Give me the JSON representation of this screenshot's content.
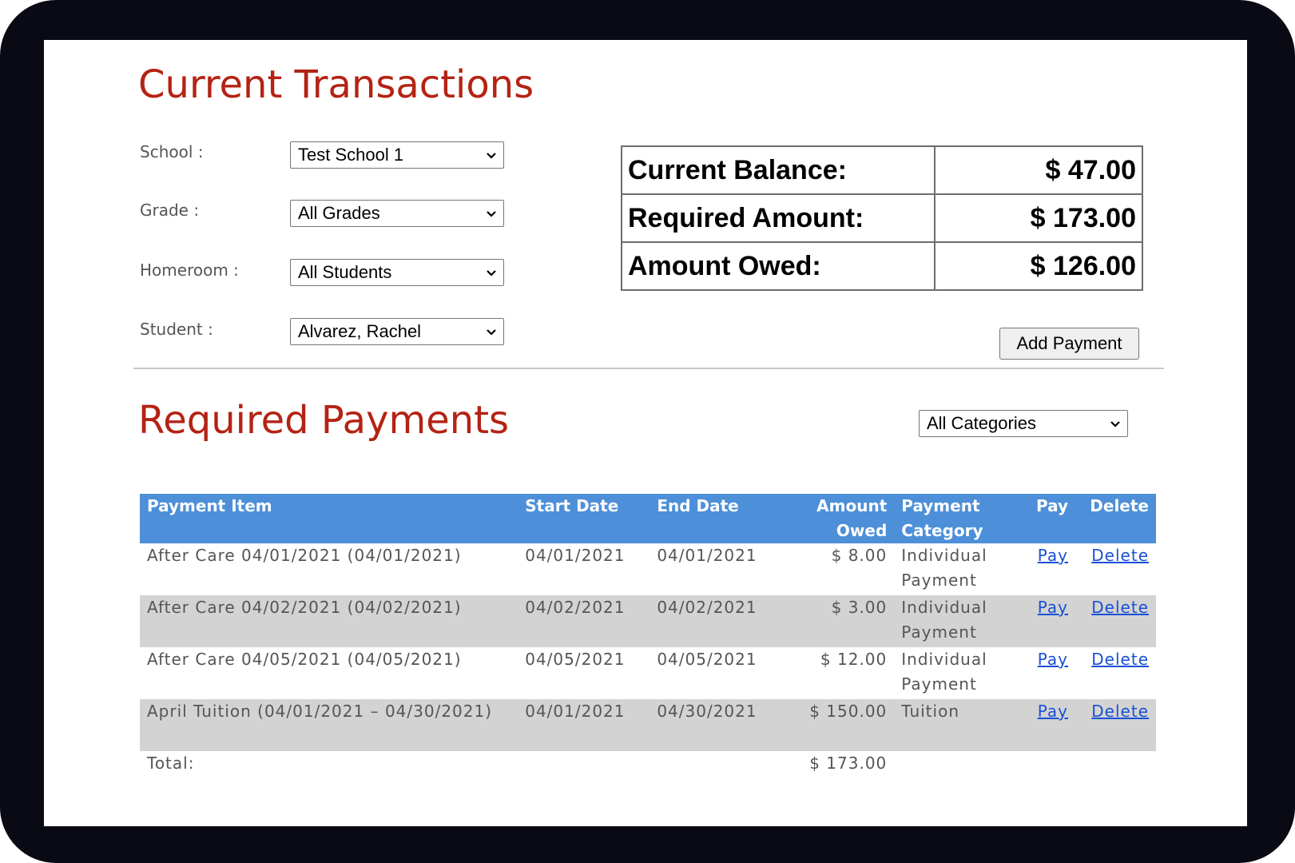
{
  "current_transactions": {
    "title": "Current Transactions",
    "filters": [
      {
        "label": "School :",
        "value": "Test School 1"
      },
      {
        "label": "Grade :",
        "value": "All Grades"
      },
      {
        "label": "Homeroom :",
        "value": "All Students"
      },
      {
        "label": "Student :",
        "value": "Alvarez, Rachel"
      }
    ],
    "balance": [
      {
        "label": "Current Balance:",
        "value": "$ 47.00"
      },
      {
        "label": "Required Amount:",
        "value": "$ 173.00"
      },
      {
        "label": "Amount Owed:",
        "value": "$ 126.00"
      }
    ],
    "add_payment_label": "Add Payment"
  },
  "required_payments": {
    "title": "Required Payments",
    "category_filter": "All Categories",
    "columns": {
      "item": "Payment Item",
      "start": "Start Date",
      "end": "End Date",
      "amount": "Amount Owed",
      "category": "Payment Category",
      "pay": "Pay",
      "delete": "Delete"
    },
    "rows": [
      {
        "item": "After Care 04/01/2021 (04/01/2021)",
        "start": "04/01/2021",
        "end": "04/01/2021",
        "amount": "$ 8.00",
        "category": "Individual Payment",
        "pay": "Pay",
        "delete": "Delete"
      },
      {
        "item": "After Care 04/02/2021 (04/02/2021)",
        "start": "04/02/2021",
        "end": "04/02/2021",
        "amount": "$ 3.00",
        "category": "Individual Payment",
        "pay": "Pay",
        "delete": "Delete"
      },
      {
        "item": "After Care 04/05/2021 (04/05/2021)",
        "start": "04/05/2021",
        "end": "04/05/2021",
        "amount": "$ 12.00",
        "category": "Individual Payment",
        "pay": "Pay",
        "delete": "Delete"
      },
      {
        "item": "April Tuition (04/01/2021 – 04/30/2021)",
        "start": "04/01/2021",
        "end": "04/30/2021",
        "amount": "$ 150.00",
        "category": "Tuition",
        "pay": "Pay",
        "delete": "Delete"
      }
    ],
    "total_label": "Total:",
    "total_value": "$ 173.00"
  },
  "colors": {
    "heading": "#b42314",
    "table_header": "#4d8fd8",
    "alt_row": "#d3d3d3",
    "link": "#1a50d6"
  }
}
